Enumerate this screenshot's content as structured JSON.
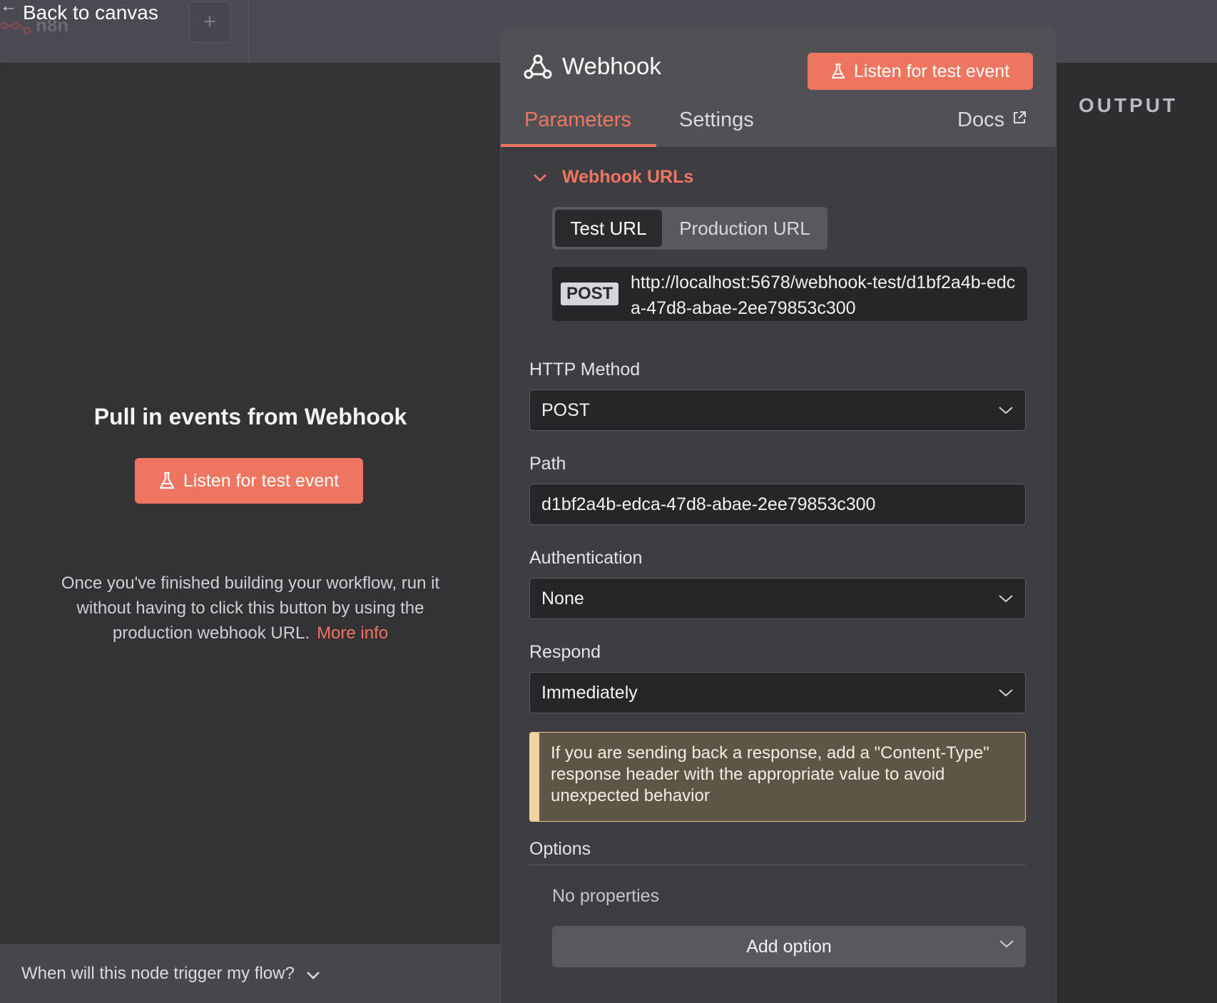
{
  "topbar": {
    "back_label": "Back to canvas",
    "logo_text": "n8n",
    "add_symbol": "+"
  },
  "input_panel": {
    "title": "Pull in events from Webhook",
    "listen_button": "Listen for test event",
    "help_text": "Once you've finished building your workflow, run it without having to click this button by using the production webhook URL.",
    "more_info_link": "More info",
    "trigger_question": "When will this node trigger my flow?"
  },
  "output_panel": {
    "label": "OUTPUT"
  },
  "node": {
    "title": "Webhook",
    "listen_button": "Listen for test event",
    "tabs": {
      "parameters": "Parameters",
      "settings": "Settings",
      "docs": "Docs"
    },
    "webhook_urls": {
      "section_title": "Webhook URLs",
      "toggle": [
        "Test URL",
        "Production URL"
      ],
      "method_badge": "POST",
      "url": "http://localhost:5678/webhook-test/d1bf2a4b-edca-47d8-abae-2ee79853c300"
    },
    "fields": {
      "http_method": {
        "label": "HTTP Method",
        "value": "POST"
      },
      "path": {
        "label": "Path",
        "value": "d1bf2a4b-edca-47d8-abae-2ee79853c300"
      },
      "authentication": {
        "label": "Authentication",
        "value": "None"
      },
      "respond": {
        "label": "Respond",
        "value": "Immediately"
      }
    },
    "callout": "If you are sending back a response, add a \"Content-Type\" response header with the appropriate value to avoid unexpected behavior",
    "options": {
      "label": "Options",
      "empty_text": "No properties",
      "add_button": "Add option"
    }
  },
  "colors": {
    "accent": "#ee7660",
    "panel_bg": "#3e3e42",
    "warning_bg": "#5e5546",
    "warning_border": "#f0d3a2"
  },
  "icons": [
    "arrow-left-icon",
    "n8n-logo-icon",
    "plus-icon",
    "flask-icon",
    "webhook-icon",
    "external-link-icon",
    "chevron-down-icon"
  ]
}
